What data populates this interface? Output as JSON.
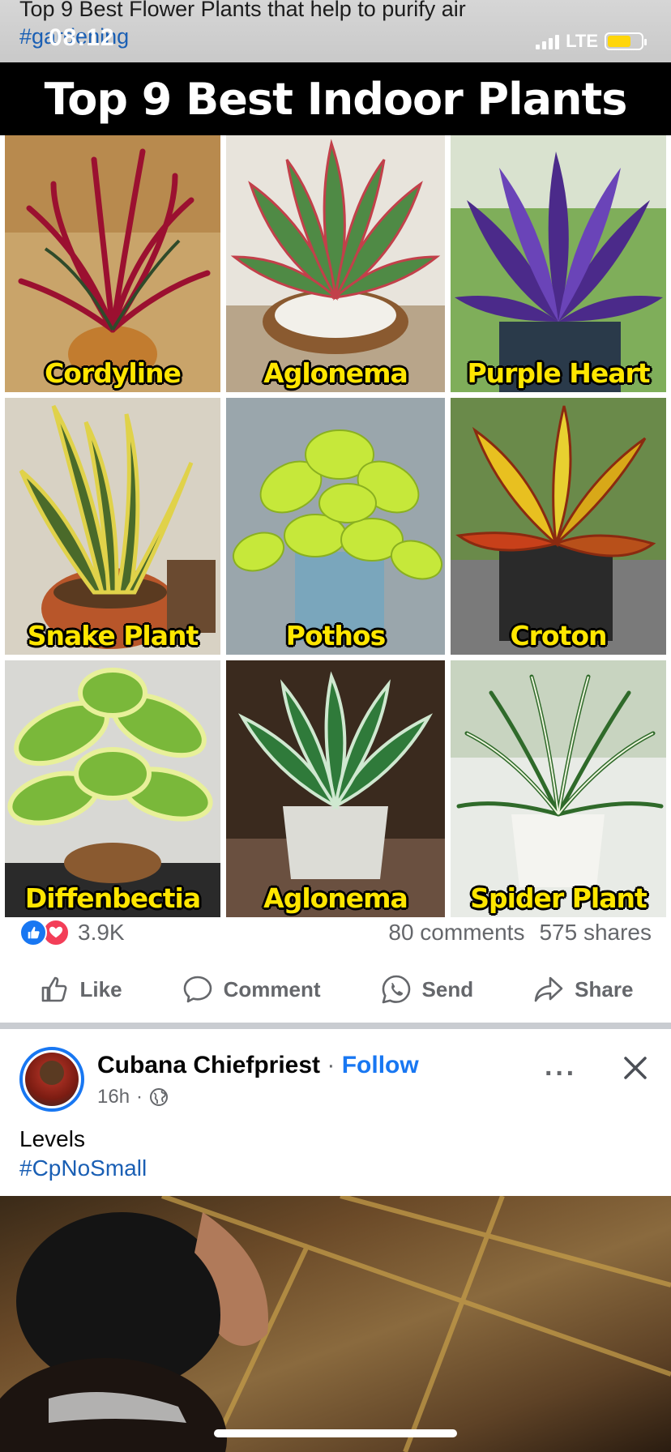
{
  "status_bar": {
    "time": "08:12",
    "network": "LTE",
    "caption_line1": "Top 9 Best Flower Plants that help to purify air",
    "caption_line2": "#gardening"
  },
  "post1": {
    "image_title": "Top 9 Best Indoor Plants",
    "plants": [
      {
        "label": "Cordyline"
      },
      {
        "label": "Aglonema"
      },
      {
        "label": "Purple Heart"
      },
      {
        "label": "Snake Plant"
      },
      {
        "label": "Pothos"
      },
      {
        "label": "Croton"
      },
      {
        "label": "Diffenbectia"
      },
      {
        "label": "Aglonema"
      },
      {
        "label": "Spider Plant"
      }
    ],
    "reaction_count": "3.9K",
    "comments": "80 comments",
    "shares": "575 shares",
    "actions": {
      "like": "Like",
      "comment": "Comment",
      "send": "Send",
      "share": "Share"
    }
  },
  "post2": {
    "author": "Cubana Chiefpriest",
    "separator": " · ",
    "follow": "Follow",
    "time": "16h",
    "dot": "·",
    "text_line1": "Levels",
    "text_line2": "#CpNoSmall",
    "more": "···"
  },
  "colors": {
    "accent": "#1877f2",
    "label_yellow": "#ffe600",
    "love_red": "#f33e58"
  }
}
